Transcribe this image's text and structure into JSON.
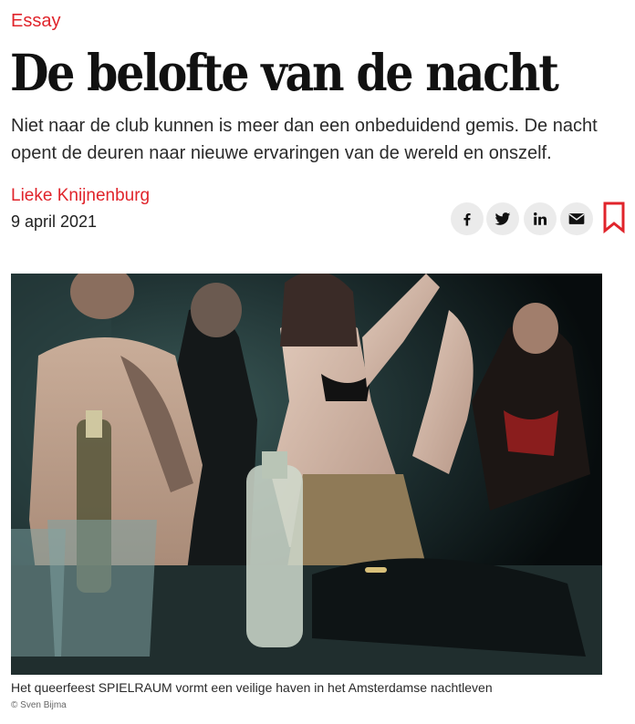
{
  "article": {
    "category": "Essay",
    "title": "De belofte van de nacht",
    "intro": "Niet naar de club kunnen is meer dan een onbeduidend gemis. De nacht opent de deuren naar nieuwe ervaringen van de wereld en onszelf.",
    "author": "Lieke Knijnenburg",
    "date": "9 april 2021"
  },
  "share": {
    "buttons": [
      {
        "icon": "facebook-icon"
      },
      {
        "icon": "twitter-icon"
      },
      {
        "icon": "linkedin-icon"
      },
      {
        "icon": "email-icon"
      }
    ],
    "bookmark_icon": "bookmark-icon"
  },
  "photo": {
    "caption": "Het queerfeest SPIELRAUM vormt een veilige haven in het Amsterdamse nachtleven",
    "credit": "© Sven Bijma"
  },
  "colors": {
    "accent": "#e0242b",
    "share_bg": "#ebebeb"
  }
}
